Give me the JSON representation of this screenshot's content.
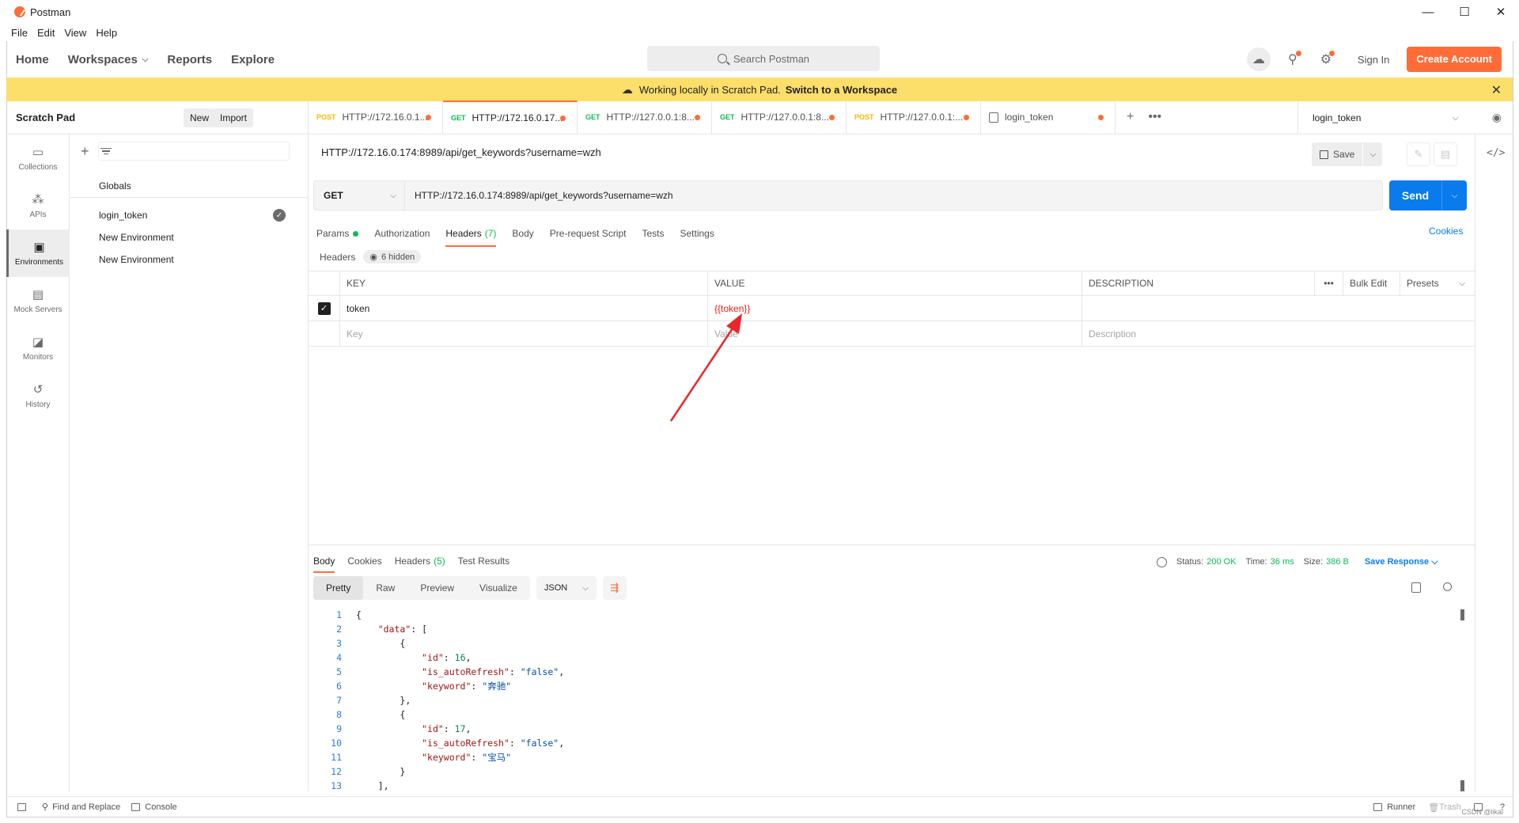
{
  "window": {
    "title": "Postman",
    "controls": [
      "—",
      "☐",
      "✕"
    ]
  },
  "menu": [
    "File",
    "Edit",
    "View",
    "Help"
  ],
  "topnav": {
    "items": [
      "Home",
      "Workspaces",
      "Reports",
      "Explore"
    ],
    "search_placeholder": "Search Postman",
    "sign_in": "Sign In",
    "create_account": "Create Account"
  },
  "banner": {
    "text": "Working locally in Scratch Pad.",
    "link": "Switch to a Workspace"
  },
  "sidebar": {
    "title": "Scratch Pad",
    "new_label": "New",
    "import_label": "Import",
    "rail": [
      "Collections",
      "APIs",
      "Environments",
      "Mock Servers",
      "Monitors",
      "History"
    ],
    "globals": "Globals",
    "environments": [
      "login_token",
      "New Environment",
      "New Environment"
    ]
  },
  "tabs": [
    {
      "method": "POST",
      "label": "HTTP://172.16.0.1..."
    },
    {
      "method": "GET",
      "label": "HTTP://172.16.0.17..."
    },
    {
      "method": "GET",
      "label": "HTTP://127.0.0.1:8..."
    },
    {
      "method": "GET",
      "label": "HTTP://127.0.0.1:8..."
    },
    {
      "method": "POST",
      "label": "HTTP://127.0.0.1:..."
    },
    {
      "method": "",
      "label": "login_token"
    }
  ],
  "env_selector": "login_token",
  "request": {
    "title": "HTTP://172.16.0.174:8989/api/get_keywords?username=wzh",
    "save_label": "Save",
    "method": "GET",
    "url": "HTTP://172.16.0.174:8989/api/get_keywords?username=wzh",
    "send_label": "Send",
    "tabs": [
      "Params",
      "Authorization",
      "Headers",
      "Body",
      "Pre-request Script",
      "Tests",
      "Settings"
    ],
    "headers_count": "(7)",
    "cookies_link": "Cookies",
    "headers_label": "Headers",
    "hidden_label": "6 hidden"
  },
  "headers_table": {
    "columns": [
      "KEY",
      "VALUE",
      "DESCRIPTION"
    ],
    "more": "•••",
    "bulk_edit": "Bulk Edit",
    "presets": "Presets",
    "rows": [
      {
        "key": "token",
        "value": "{{token}}",
        "description": ""
      }
    ],
    "placeholders": {
      "key": "Key",
      "value": "Value",
      "description": "Description"
    }
  },
  "response": {
    "tabs": [
      "Body",
      "Cookies",
      "Headers",
      "Test Results"
    ],
    "headers_count": "(5)",
    "status_label": "Status:",
    "status_value": "200 OK",
    "time_label": "Time:",
    "time_value": "36 ms",
    "size_label": "Size:",
    "size_value": "386 B",
    "save_response": "Save Response",
    "views": [
      "Pretty",
      "Raw",
      "Preview",
      "Visualize"
    ],
    "format": "JSON",
    "code_lines": [
      {
        "n": "1",
        "indent": "",
        "html": "{"
      },
      {
        "n": "2",
        "indent": "    ",
        "key": "\"data\"",
        "rest": ": ["
      },
      {
        "n": "3",
        "indent": "        ",
        "html": "{"
      },
      {
        "n": "4",
        "indent": "            ",
        "key": "\"id\"",
        "rest": ": ",
        "num": "16",
        "tail": ","
      },
      {
        "n": "5",
        "indent": "            ",
        "key": "\"is_autoRefresh\"",
        "rest": ": ",
        "str": "\"false\"",
        "tail": ","
      },
      {
        "n": "6",
        "indent": "            ",
        "key": "\"keyword\"",
        "rest": ": ",
        "str": "\"奔驰\"",
        "tail": ""
      },
      {
        "n": "7",
        "indent": "        ",
        "html": "},"
      },
      {
        "n": "8",
        "indent": "        ",
        "html": "{"
      },
      {
        "n": "9",
        "indent": "            ",
        "key": "\"id\"",
        "rest": ": ",
        "num": "17",
        "tail": ","
      },
      {
        "n": "10",
        "indent": "            ",
        "key": "\"is_autoRefresh\"",
        "rest": ": ",
        "str": "\"false\"",
        "tail": ","
      },
      {
        "n": "11",
        "indent": "            ",
        "key": "\"keyword\"",
        "rest": ": ",
        "str": "\"宝马\"",
        "tail": ""
      },
      {
        "n": "12",
        "indent": "        ",
        "html": "}"
      },
      {
        "n": "13",
        "indent": "    ",
        "html": "],"
      }
    ]
  },
  "statusbar": {
    "find_replace": "Find and Replace",
    "console": "Console",
    "runner": "Runner",
    "trash": "Trash",
    "watermark": "CSDN @likal"
  },
  "colors": {
    "accent": "#ff6c37",
    "send": "#097bed",
    "banner": "#fcde6b",
    "success": "#0cbb52",
    "variable": "#eb2013"
  }
}
